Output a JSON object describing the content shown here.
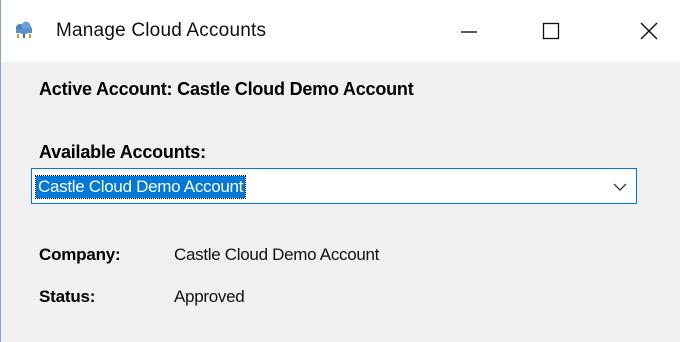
{
  "window": {
    "title": "Manage Cloud Accounts",
    "icon": "cloud-app-icon",
    "controls": {
      "minimize_icon": "minimize-icon",
      "maximize_icon": "maximize-icon",
      "close_icon": "close-icon"
    }
  },
  "main": {
    "active_account_text": "Active Account: Castle Cloud Demo Account",
    "available_accounts_label": "Available Accounts:",
    "accounts_dropdown": {
      "selected_value": "Castle Cloud Demo Account",
      "arrow_icon": "chevron-down-icon"
    },
    "details": {
      "company_label": "Company:",
      "company_value": "Castle Cloud Demo Account",
      "status_label": "Status:",
      "status_value": "Approved"
    }
  },
  "colors": {
    "accent": "#0078d7",
    "window_background": "#f0f0f0",
    "titlebar_background": "#ffffff"
  }
}
